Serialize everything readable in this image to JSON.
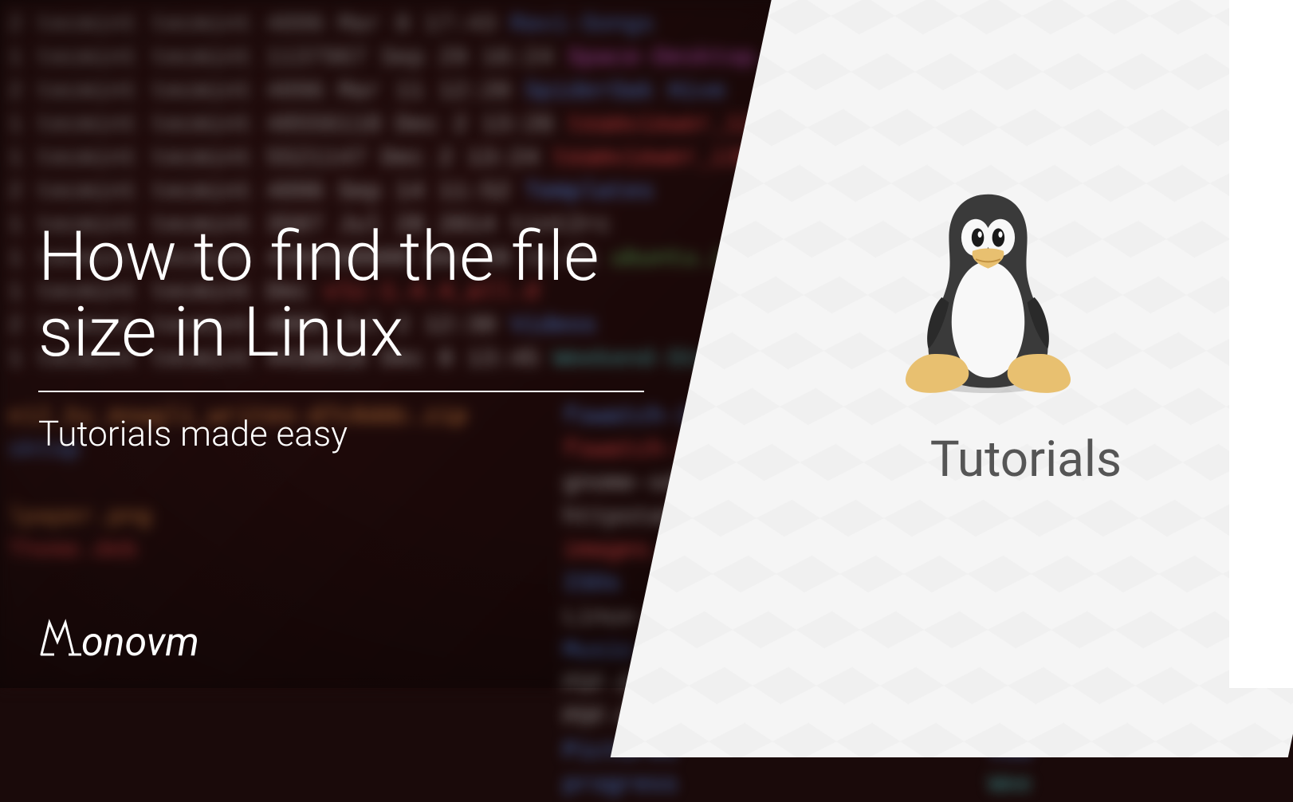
{
  "banner": {
    "title": "How to find the file size in Linux",
    "subtitle": "Tutorials made easy",
    "sidebar_label": "Tutorials"
  },
  "logo": {
    "text": "onovm",
    "icon_letter": "M"
  },
  "icons": {
    "tux": "linux-tux-icon"
  },
  "terminal_bg": {
    "lines": [
      {
        "prefix": "2 tecmint tecmint        4096 Mar  8 17:43 ",
        "suffix": "Ravi-Songs",
        "color": "t-blue"
      },
      {
        "prefix": "1 tecmint tecmint     1137967 Sep 29 16:24 ",
        "suffix": "Space-Desktop.jpg",
        "color": "t-magenta"
      },
      {
        "prefix": "2 tecmint tecmint        4096 Mar 11 12:20 ",
        "suffix": "SpiderOak Hive",
        "color": "t-blue"
      },
      {
        "prefix": "1 tecmint tecmint    48556118 Dec  2 13:26 ",
        "suffix": "teamviewer_12.0.71510_",
        "color": "t-red"
      },
      {
        "prefix": "1 tecmint tecmint     5521147 Dec  2 13:24 ",
        "suffix": "teamviewer_i386.deb",
        "color": "t-red"
      },
      {
        "prefix": "2 tecmint tecmint        4096 Sep 14 11:52 ",
        "suffix": "Templates",
        "color": "t-blue"
      },
      {
        "prefix": "1 tecmint tecmint        3587 Jul 28  2014 ",
        "suffix": "tint2rc",
        "color": "t-white"
      },
      {
        "prefix": "1 tecmint tecmint  4394280688 Dec 28 11:51 ",
        "suffix": "ubuntu.iso",
        "color": "t-green"
      },
      {
        "prefix": "1 tecmint tecmint             Dec          ",
        "suffix": "vlc-1.4.4_all.d",
        "color": "t-red"
      },
      {
        "prefix": "2 tecmint tecmint        4096 Jul  2 12:30 ",
        "suffix": "Videos",
        "color": "t-blue"
      },
      {
        "prefix": "1 tecmint tecmint     4438016 Dec  8 13:45 ",
        "suffix": "Weekend-StarBoy.mp3",
        "color": "t-cyan"
      }
    ],
    "col2_lines": [
      {
        "text": "fswatch-1.9.3",
        "color": "t-blue"
      },
      {
        "text": "fswatch-1.9.3.tar.gz",
        "color": "t-red"
      },
      {
        "text": "gnome-sdk.gpg",
        "color": "t-white"
      },
      {
        "text": "httpstat.py",
        "color": "t-white"
      },
      {
        "text": "images.tar.gz",
        "color": "t-red"
      },
      {
        "text": "ISOs",
        "color": "t-blue"
      },
      {
        "text": "Linux-ISO.tar.gz",
        "color": "t-white"
      },
      {
        "text": "Music",
        "color": "t-blue"
      },
      {
        "text": "PDF-Editors.pdf",
        "color": "t-white"
      },
      {
        "text": "PDF-Editors.pdfcrop.pdf",
        "color": "t-white"
      },
      {
        "text": "Pictures",
        "color": "t-blue"
      },
      {
        "text": "progress",
        "color": "t-blue"
      }
    ],
    "col1_extra": [
      {
        "text": "sktop",
        "color": "t-blue"
      },
      {
        "text": "",
        "color": "t-white"
      },
      {
        "text": "lpaper.png",
        "color": "t-orange"
      },
      {
        "text": "Theme.deb",
        "color": "t-red"
      }
    ],
    "zip_line": "e12_by_mowgli_writes-d7c6ddc.zip"
  }
}
